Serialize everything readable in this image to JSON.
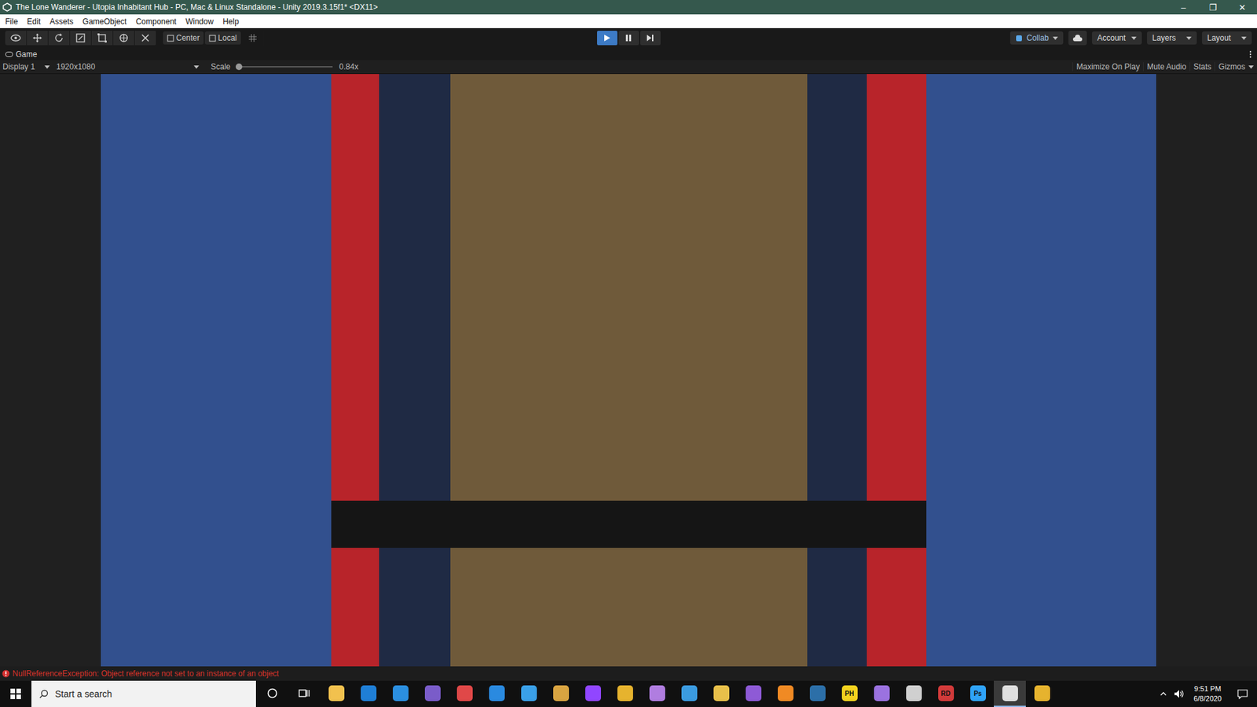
{
  "window": {
    "title": "The Lone Wanderer - Utopia Inhabitant Hub - PC, Mac & Linux Standalone - Unity 2019.3.15f1* <DX11>",
    "controls": [
      "–",
      "❐",
      "✕"
    ]
  },
  "menu": [
    "File",
    "Edit",
    "Assets",
    "GameObject",
    "Component",
    "Window",
    "Help"
  ],
  "toolbar": {
    "pivot": [
      {
        "label": "Center"
      },
      {
        "label": "Local"
      }
    ],
    "playback": [
      {
        "kind": "play",
        "selected": true
      },
      {
        "kind": "pause",
        "selected": false
      },
      {
        "kind": "step",
        "selected": false
      }
    ],
    "collab": "Collab",
    "account": "Account",
    "layers": "Layers",
    "layout": "Layout"
  },
  "game_tab": {
    "label": "Game"
  },
  "game_bar": {
    "display": "Display 1",
    "resolution": "1920x1080",
    "scale_label": "Scale",
    "scale_level": 0.0,
    "scale_reading": "0.84x",
    "toggles": [
      {
        "label": "Maximize On Play",
        "dropdown": false
      },
      {
        "label": "Mute Audio",
        "dropdown": false
      },
      {
        "label": "Stats",
        "dropdown": false
      },
      {
        "label": "Gizmos",
        "dropdown": true
      }
    ]
  },
  "status": {
    "message": "NullReferenceException: Object reference not set to an instance of an object"
  },
  "taskbar": {
    "search_placeholder": "Start a search",
    "time": "9:51 PM",
    "date": "6/8/2020",
    "apps": [
      {
        "label": "",
        "color": "#f2c14e",
        "active": false
      },
      {
        "label": "",
        "color": "#1f7fd6",
        "active": false
      },
      {
        "label": "",
        "color": "#2b8fe0",
        "active": false
      },
      {
        "label": "",
        "color": "#7a5cc9",
        "active": false
      },
      {
        "label": "",
        "color": "#e04848",
        "active": false
      },
      {
        "label": "",
        "color": "#2a8ae0",
        "active": false
      },
      {
        "label": "",
        "color": "#3aa0e8",
        "active": false
      },
      {
        "label": "",
        "color": "#d9a441",
        "active": false
      },
      {
        "label": "",
        "color": "#9146ff",
        "active": false
      },
      {
        "label": "",
        "color": "#e6b32e",
        "active": false
      },
      {
        "label": "",
        "color": "#b07de0",
        "active": false
      },
      {
        "label": "",
        "color": "#3b9be0",
        "active": false
      },
      {
        "label": "",
        "color": "#e8c04a",
        "active": false
      },
      {
        "label": "",
        "color": "#8e5ad6",
        "active": false
      },
      {
        "label": "",
        "color": "#f08a24",
        "active": false
      },
      {
        "label": "",
        "color": "#2c6fa8",
        "active": false
      },
      {
        "label": "PH",
        "color": "#f4d21f",
        "active": false
      },
      {
        "label": "",
        "color": "#9b72e0",
        "active": false
      },
      {
        "label": "",
        "color": "#d0d0d0",
        "active": false
      },
      {
        "label": "RD",
        "color": "#d23a3a",
        "active": false
      },
      {
        "label": "Ps",
        "color": "#2fa3f7",
        "active": false
      },
      {
        "label": "",
        "color": "#e0e0e0",
        "active": true
      },
      {
        "label": "",
        "color": "#e6b32e",
        "active": false
      }
    ]
  }
}
